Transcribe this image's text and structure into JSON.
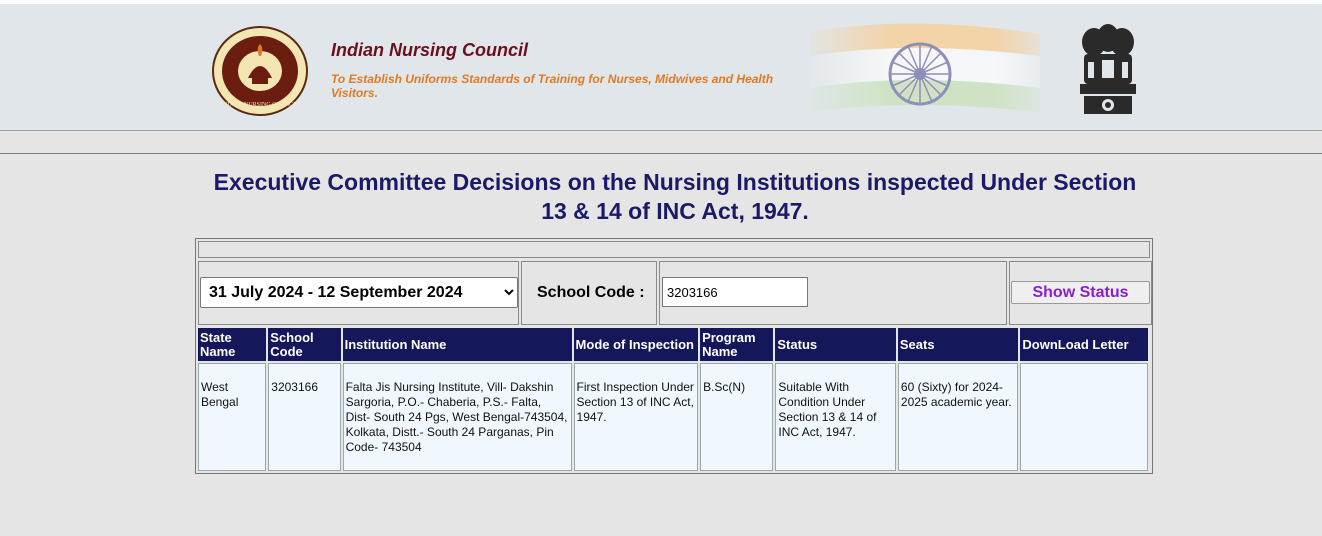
{
  "header": {
    "org_name": "Indian Nursing Council",
    "tagline": "To Establish Uniforms Standards of Training for Nurses, Midwives and Health Visitors.",
    "logo_text": "INDIAN NURSING COUNCIL"
  },
  "page_title": "Executive Committee Decisions on the Nursing Institutions inspected Under Section 13 & 14 of INC Act, 1947.",
  "filters": {
    "period_selected": "31 July 2024 - 12 September 2024",
    "school_code_label": "School Code :",
    "school_code_value": "3203166",
    "show_status_label": "Show Status"
  },
  "table": {
    "headers": [
      "State Name",
      "School Code",
      "Institution Name",
      "Mode of Inspection",
      "Program Name",
      "Status",
      "Seats",
      "DownLoad Letter"
    ],
    "rows": [
      {
        "state": "West Bengal",
        "school_code": "3203166",
        "institution": "Falta Jis Nursing Institute, Vill- Dakshin Sargoria, P.O.- Chaberia, P.S.- Falta, Dist- South 24 Pgs, West Bengal-743504, Kolkata, Distt.- South 24 Parganas, Pin Code- 743504",
        "mode": "First Inspection Under Section 13 of INC Act, 1947.",
        "program": "B.Sc(N)",
        "status": "Suitable With Condition Under Section 13 & 14 of INC Act, 1947.",
        "seats": "60 (Sixty) for 2024-2025 academic year.",
        "download": ""
      }
    ]
  },
  "colors": {
    "org_name": "#6b1020",
    "tagline": "#e07a22",
    "title": "#1a1a66",
    "table_header_bg": "#14175a",
    "table_cell_bg": "#f0f7fe",
    "show_status_text": "#8a1fc9"
  },
  "icons": [
    "inc-logo-icon",
    "india-flag-icon",
    "national-emblem-icon",
    "chevron-down-icon"
  ]
}
